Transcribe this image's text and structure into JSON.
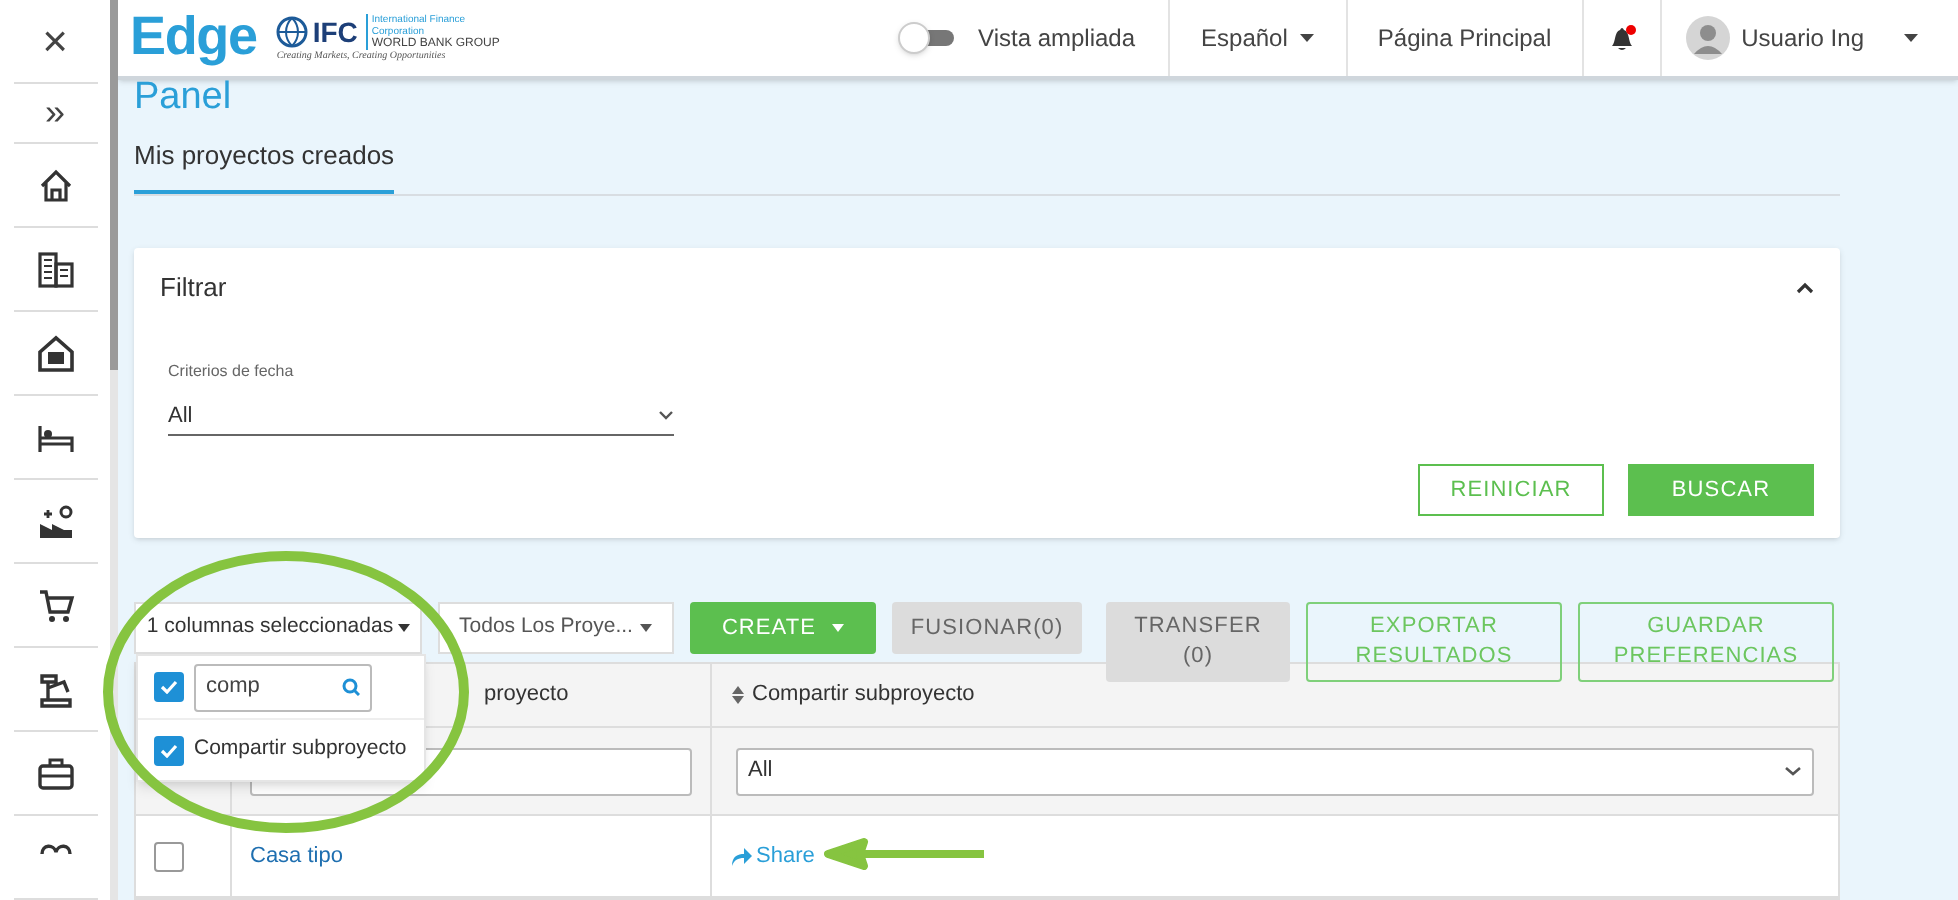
{
  "sidebar": {
    "close_glyph": "×",
    "expand_glyph": "»",
    "items": [
      {
        "kind": "home"
      },
      {
        "kind": "building"
      },
      {
        "kind": "house"
      },
      {
        "kind": "bed"
      },
      {
        "kind": "factory"
      },
      {
        "kind": "cart"
      },
      {
        "kind": "robot"
      },
      {
        "kind": "briefcase"
      },
      {
        "kind": "partial"
      }
    ]
  },
  "header": {
    "logo": {
      "name": "Edge",
      "partner": "IFC",
      "partner_full": "International Finance Corporation",
      "partner_group": "WORLD BANK GROUP",
      "tagline": "Creating Markets, Creating Opportunities"
    },
    "toggle": {
      "label": "Vista ampliada",
      "on": false
    },
    "language": "Español",
    "home_link": "Página Principal",
    "notifications": {
      "unread": true
    },
    "user": "Usuario Ing"
  },
  "page": {
    "title": "Panel",
    "tabs": [
      {
        "label": "Mis proyectos creados",
        "selected": true
      }
    ]
  },
  "filter": {
    "title": "Filtrar",
    "expanded": true,
    "date_label": "Criterios de fecha",
    "date_value": "All",
    "reset": "REINICIAR",
    "search": "BUSCAR"
  },
  "toolbar": [
    {
      "kind": "dropdown",
      "label": "1 columnas seleccionadas"
    },
    {
      "kind": "select",
      "label": "Todos Los Proye..."
    },
    {
      "kind": "primary",
      "label": "CREATE"
    },
    {
      "kind": "disabled",
      "label": "FUSIONAR(0)"
    },
    {
      "kind": "disabled2",
      "label": "TRANSFER",
      "sub": "(0)"
    },
    {
      "kind": "outline",
      "label": "EXPORTAR",
      "sub": "RESULTADOS"
    },
    {
      "kind": "outline",
      "label": "GUARDAR",
      "sub": "PREFERENCIAS"
    }
  ],
  "column_picker": {
    "select_all": true,
    "search": "comp",
    "options": [
      {
        "label": "Compartir subproyecto",
        "checked": true
      }
    ]
  },
  "table": {
    "columns": [
      {
        "label": "proyecto",
        "sortable": false
      },
      {
        "label": "Compartir subproyecto",
        "sortable": true
      }
    ],
    "filters": {
      "column_3": "All"
    },
    "rows": [
      {
        "checked": false,
        "name": "Casa tipo",
        "share": "Share"
      }
    ]
  }
}
